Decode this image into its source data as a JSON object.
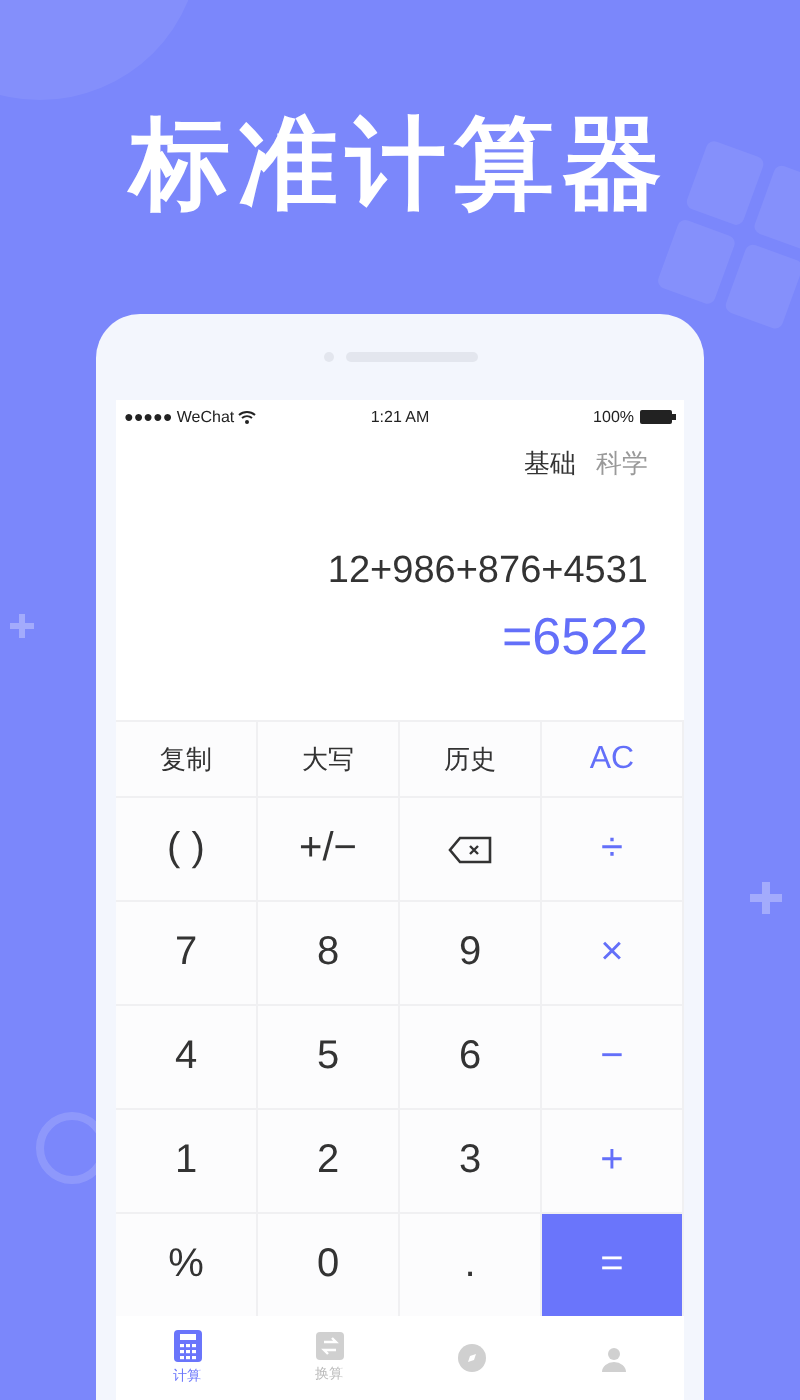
{
  "headline": "标准计算器",
  "status_bar": {
    "carrier": "●●●●● WeChat",
    "time": "1:21 AM",
    "battery": "100%"
  },
  "modes": [
    {
      "label": "基础",
      "selected": true
    },
    {
      "label": "科学",
      "selected": false
    }
  ],
  "display": {
    "expression": "12+986+876+4531",
    "result": "=6522"
  },
  "keys": [
    {
      "label": "复制",
      "kind": "function"
    },
    {
      "label": "大写",
      "kind": "function"
    },
    {
      "label": "历史",
      "kind": "function"
    },
    {
      "label": "AC",
      "kind": "clear"
    },
    {
      "label": "( )",
      "kind": "digit"
    },
    {
      "label": "+/−",
      "kind": "digit"
    },
    {
      "kind": "backspace"
    },
    {
      "label": "÷",
      "kind": "operator"
    },
    {
      "label": "7",
      "kind": "digit"
    },
    {
      "label": "8",
      "kind": "digit"
    },
    {
      "label": "9",
      "kind": "digit"
    },
    {
      "label": "×",
      "kind": "operator"
    },
    {
      "label": "4",
      "kind": "digit"
    },
    {
      "label": "5",
      "kind": "digit"
    },
    {
      "label": "6",
      "kind": "digit"
    },
    {
      "label": "−",
      "kind": "operator"
    },
    {
      "label": "1",
      "kind": "digit"
    },
    {
      "label": "2",
      "kind": "digit"
    },
    {
      "label": "3",
      "kind": "digit"
    },
    {
      "label": "+",
      "kind": "operator"
    },
    {
      "label": "%",
      "kind": "digit"
    },
    {
      "label": "0",
      "kind": "digit"
    },
    {
      "label": ".",
      "kind": "digit"
    },
    {
      "label": "=",
      "kind": "equals"
    }
  ],
  "tabs": [
    {
      "label": "计算",
      "kind": "calculator",
      "selected": true
    },
    {
      "label": "换算",
      "kind": "convert",
      "selected": false
    },
    {
      "kind": "compass",
      "selected": false
    },
    {
      "kind": "person",
      "selected": false
    }
  ]
}
